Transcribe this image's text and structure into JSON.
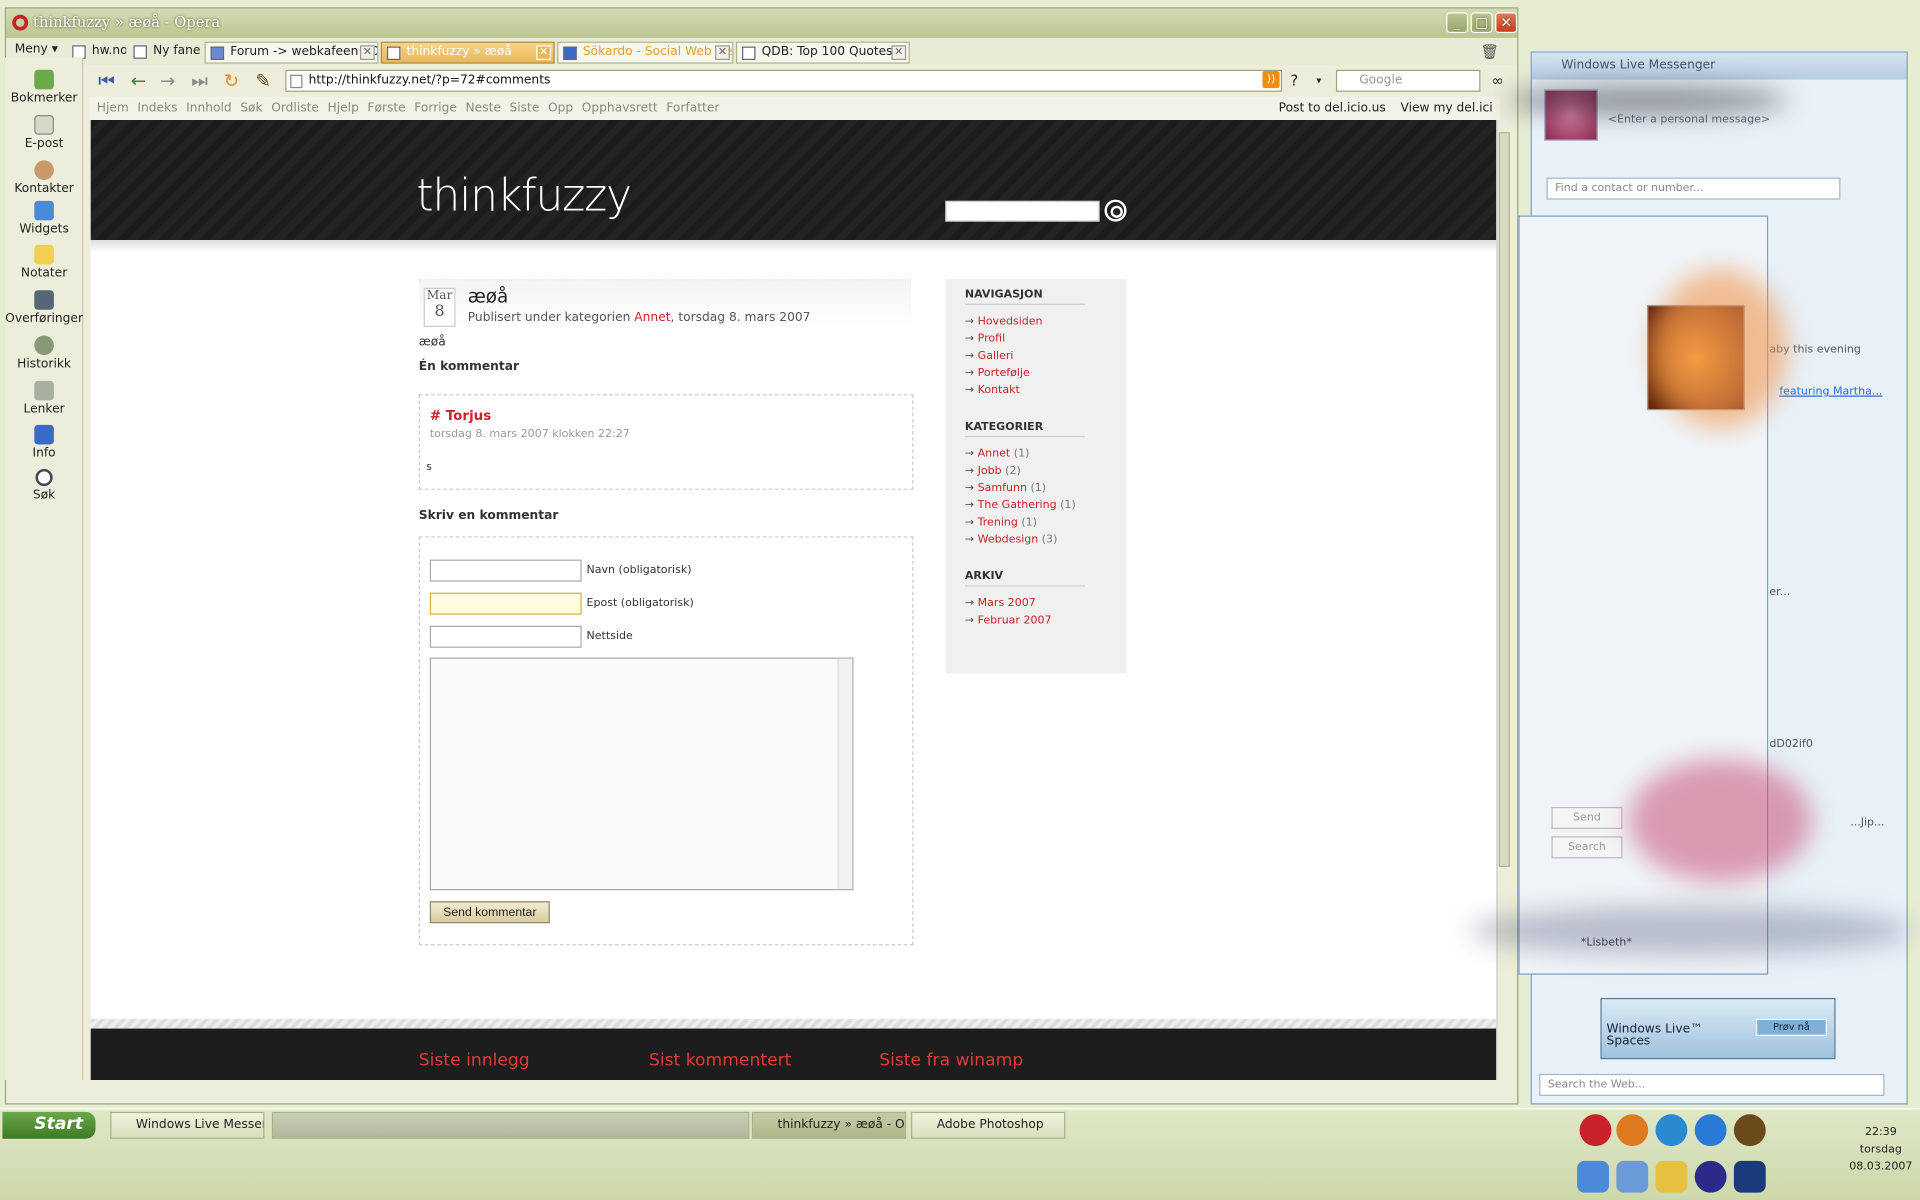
{
  "opera": {
    "title": "thinkfuzzy » æøå - Opera",
    "menu_label": "Meny",
    "bookmark_links": [
      "hw.no",
      "Ny fane"
    ],
    "tabs": [
      {
        "label": "Forum -> webkafeen - Di..."
      },
      {
        "label": "thinkfuzzy » æøå",
        "active": true
      },
      {
        "label": "Sökardo - Social Web De..."
      },
      {
        "label": "QDB: Top 100 Quotes"
      }
    ],
    "url": "http://thinkfuzzy.net/?p=72#comments",
    "search_placeholder": "Google",
    "nav_links": [
      "Hjem",
      "Indeks",
      "Innhold",
      "Søk",
      "Ordliste",
      "Hjelp",
      "Første",
      "Forrige",
      "Neste",
      "Siste",
      "Opp",
      "Opphavsrett",
      "Forfatter"
    ],
    "nav_right": [
      "Post to del.icio.us",
      "View my del.ici"
    ],
    "sidebar": [
      "Bokmerker",
      "E-post",
      "Kontakter",
      "Widgets",
      "Notater",
      "Overføringer",
      "Historikk",
      "Lenker",
      "Info",
      "Søk"
    ]
  },
  "page": {
    "logo": "thinkfuzzy",
    "post": {
      "month": "Mar",
      "day": "8",
      "title": "æøå",
      "meta_prefix": "Publisert under kategorien",
      "meta_category": "Annet",
      "meta_date": ", torsdag 8. mars 2007",
      "body": "æøå",
      "comments_heading": "Én kommentar"
    },
    "comment": {
      "author": "# Torjus",
      "date": "torsdag 8. mars 2007 klokken 22:27",
      "text": "s"
    },
    "form": {
      "heading": "Skriv en kommentar",
      "name_label": "Navn (obligatorisk)",
      "email_label": "Epost (obligatorisk)",
      "site_label": "Nettside",
      "submit": "Send kommentar"
    },
    "sidebar": {
      "nav_heading": "NAVIGASJON",
      "nav": [
        "Hovedsiden",
        "Profil",
        "Galleri",
        "Portefølje",
        "Kontakt"
      ],
      "cat_heading": "KATEGORIER",
      "categories": [
        {
          "name": "Annet",
          "count": "(1)"
        },
        {
          "name": "Jobb",
          "count": "(2)"
        },
        {
          "name": "Samfunn",
          "count": "(1)"
        },
        {
          "name": "The Gathering",
          "count": "(1)"
        },
        {
          "name": "Trening",
          "count": "(1)"
        },
        {
          "name": "Webdesign",
          "count": "(3)"
        }
      ],
      "archive_heading": "ARKIV",
      "archive": [
        "Mars 2007",
        "Februar 2007"
      ]
    },
    "footer": [
      "Siste innlegg",
      "Sist kommentert",
      "Siste fra winamp"
    ]
  },
  "messenger": {
    "title": "Windows Live Messenger",
    "personal_message": "<Enter a personal message>",
    "find_placeholder": "Find a contact or number...",
    "web_placeholder": "Search the Web...",
    "ad_text_1": "Windows Live™",
    "ad_text_2": "Spaces",
    "ad_button": "Prøv nå",
    "conv_text_1": "aby this evening",
    "conv_text_2": "featuring Martha...",
    "conv_text_3": "er...",
    "conv_text_4": "dD02if0",
    "conv_text_5": "...Jip...",
    "send": "Send",
    "search": "Search",
    "contact": "*Lisbeth*"
  },
  "taskbar": {
    "start": "Start",
    "buttons": [
      "Windows Live Messen...",
      "thinkfuzzy » æøå - O...",
      "Adobe Photoshop"
    ],
    "time": "22:39",
    "day": "torsdag",
    "date": "08.03.2007"
  }
}
